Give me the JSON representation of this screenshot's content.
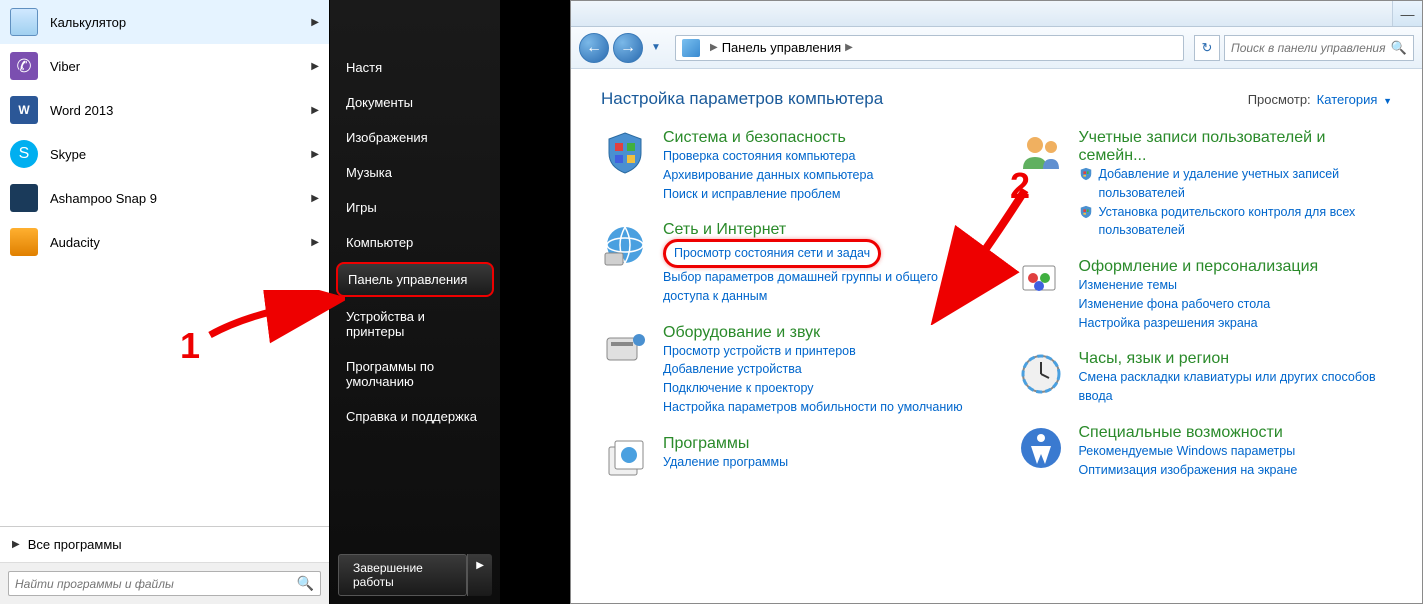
{
  "start_menu": {
    "programs": [
      {
        "label": "Калькулятор",
        "icon": "ic-calc",
        "glyph": ""
      },
      {
        "label": "Viber",
        "icon": "ic-viber",
        "glyph": "✆"
      },
      {
        "label": "Word 2013",
        "icon": "ic-word",
        "glyph": "W"
      },
      {
        "label": "Skype",
        "icon": "ic-skype",
        "glyph": "S"
      },
      {
        "label": "Ashampoo Snap 9",
        "icon": "ic-snap",
        "glyph": ""
      },
      {
        "label": "Audacity",
        "icon": "ic-audacity",
        "glyph": ""
      }
    ],
    "all_programs": "Все программы",
    "search_placeholder": "Найти программы и файлы",
    "right_items": [
      "Настя",
      "Документы",
      "Изображения",
      "Музыка",
      "Игры",
      "Компьютер",
      "Панель управления",
      "Устройства и принтеры",
      "Программы по умолчанию",
      "Справка и поддержка"
    ],
    "highlighted_index": 6,
    "shutdown_label": "Завершение работы"
  },
  "annotations": {
    "num1": "1",
    "num2": "2"
  },
  "control_panel": {
    "breadcrumb": "Панель управления",
    "search_placeholder": "Поиск в панели управления",
    "page_title": "Настройка параметров компьютера",
    "view_by_label": "Просмотр:",
    "view_by_value": "Категория",
    "categories_left": [
      {
        "title": "Система и безопасность",
        "links": [
          "Проверка состояния компьютера",
          "Архивирование данных компьютера",
          "Поиск и исправление проблем"
        ]
      },
      {
        "title": "Сеть и Интернет",
        "links": [
          "Просмотр состояния сети и задач",
          "Выбор параметров домашней группы и общего доступа к данным"
        ],
        "highlight_link_index": 0
      },
      {
        "title": "Оборудование и звук",
        "links": [
          "Просмотр устройств и принтеров",
          "Добавление устройства",
          "Подключение к проектору",
          "Настройка параметров мобильности по умолчанию"
        ]
      },
      {
        "title": "Программы",
        "links": [
          "Удаление программы"
        ]
      }
    ],
    "categories_right": [
      {
        "title": "Учетные записи пользователей и семейн...",
        "bullet_links": [
          "Добавление и удаление учетных записей пользователей",
          "Установка родительского контроля для всех пользователей"
        ]
      },
      {
        "title": "Оформление и персонализация",
        "links": [
          "Изменение темы",
          "Изменение фона рабочего стола",
          "Настройка разрешения экрана"
        ]
      },
      {
        "title": "Часы, язык и регион",
        "links": [
          "Смена раскладки клавиатуры или других способов ввода"
        ]
      },
      {
        "title": "Специальные возможности",
        "links": [
          "Рекомендуемые Windows параметры",
          "Оптимизация изображения на экране"
        ]
      }
    ]
  }
}
